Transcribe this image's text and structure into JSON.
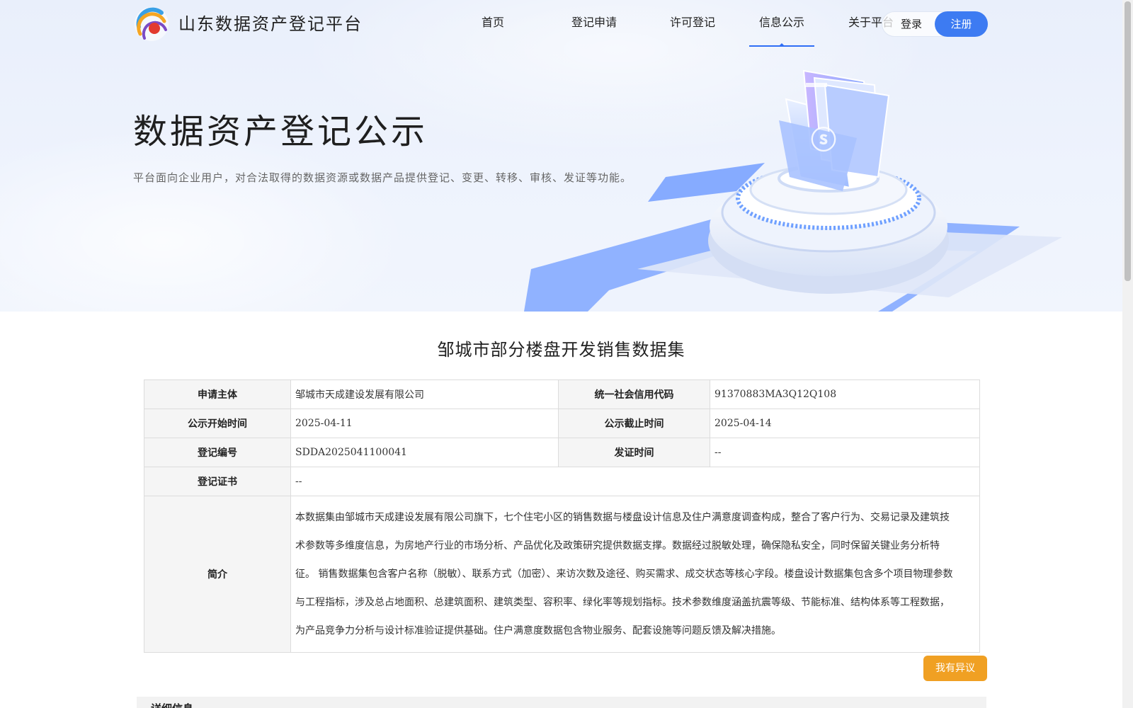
{
  "header": {
    "site_title": "山东数据资产登记平台",
    "nav": [
      {
        "label": "首页",
        "active": false
      },
      {
        "label": "登记申请",
        "active": false
      },
      {
        "label": "许可登记",
        "active": false
      },
      {
        "label": "信息公示",
        "active": true
      },
      {
        "label": "关于平台",
        "active": false
      }
    ],
    "login_label": "登录",
    "register_label": "注册",
    "accent_color": "#3d7bf2"
  },
  "hero": {
    "title": "数据资产登记公示",
    "description": "平台面向企业用户，对合法取得的数据资源或数据产品提供登记、变更、转移、审核、发证等功能。"
  },
  "record": {
    "title": "邹城市部分楼盘开发销售数据集",
    "applicant_label": "申请主体",
    "applicant": "邹城市天成建设发展有限公司",
    "credit_code_label": "统一社会信用代码",
    "credit_code": "91370883MA3Q12Q108",
    "publicity_start_label": "公示开始时间",
    "publicity_start": "2025-04-11",
    "publicity_end_label": "公示截止时间",
    "publicity_end": "2025-04-14",
    "registration_no_label": "登记编号",
    "registration_no": "SDDA2025041100041",
    "issue_time_label": "发证时间",
    "issue_time": "--",
    "certificate_label": "登记证书",
    "certificate": "--",
    "intro_label": "简介",
    "intro": "本数据集由邹城市天成建设发展有限公司旗下，七个住宅小区的销售数据与楼盘设计信息及住户满意度调查构成，整合了客户行为、交易记录及建筑技术参数等多维度信息，为房地产行业的市场分析、产品优化及政策研究提供数据支撑。数据经过脱敏处理，确保隐私安全，同时保留关键业务分析特征。 销售数据集包含客户名称（脱敏）、联系方式（加密）、来访次数及途径、购买需求、成交状态等核心字段。楼盘设计数据集包含多个项目物理参数与工程指标，涉及总占地面积、总建筑面积、建筑类型、容积率、绿化率等规划指标。技术参数维度涵盖抗震等级、节能标准、结构体系等工程数据，为产品竞争力分析与设计标准验证提供基础。住户满意度数据包含物业服务、配套设施等问题反馈及解决措施。"
  },
  "actions": {
    "objection_label": "我有异议",
    "objection_color": "#f0a023"
  },
  "detail": {
    "heading": "详细信息"
  }
}
